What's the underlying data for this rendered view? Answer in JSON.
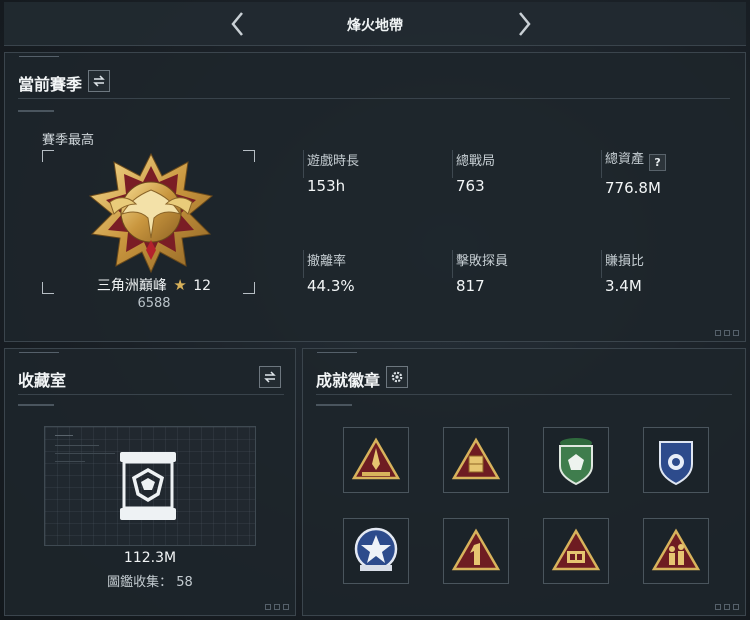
{
  "topbar": {
    "title": "烽火地帶"
  },
  "season": {
    "title": "當前賽季",
    "best_label": "賽季最高",
    "rank_name": "三角洲巔峰",
    "rank_stars": "12",
    "rank_points": "6588",
    "stats": [
      {
        "label": "遊戲時長",
        "value": "153h"
      },
      {
        "label": "總戰局",
        "value": "763"
      },
      {
        "label": "總資產",
        "value": "776.8M"
      },
      {
        "label": "撤離率",
        "value": "44.3%"
      },
      {
        "label": "擊敗探員",
        "value": "817"
      },
      {
        "label": "賺損比",
        "value": "3.4M"
      }
    ],
    "help_glyph": "?"
  },
  "collection": {
    "title": "收藏室",
    "value": "112.3M",
    "count_text": "圖鑑收集： 58"
  },
  "achievements": {
    "title": "成就徽章",
    "badges": [
      {
        "icon": "gold-rocket-triangle-badge"
      },
      {
        "icon": "gold-crate-triangle-badge"
      },
      {
        "icon": "green-shield-badge"
      },
      {
        "icon": "blue-shield-badge"
      },
      {
        "icon": "blue-star-emblem-badge"
      },
      {
        "icon": "gold-number-one-badge"
      },
      {
        "icon": "gold-58-triangle-badge"
      },
      {
        "icon": "gold-soldiers-triangle-badge"
      }
    ]
  },
  "colors": {
    "gold": "#d8b35c",
    "accent_red": "#8c1f27",
    "panel_bg": "#1e252b"
  }
}
